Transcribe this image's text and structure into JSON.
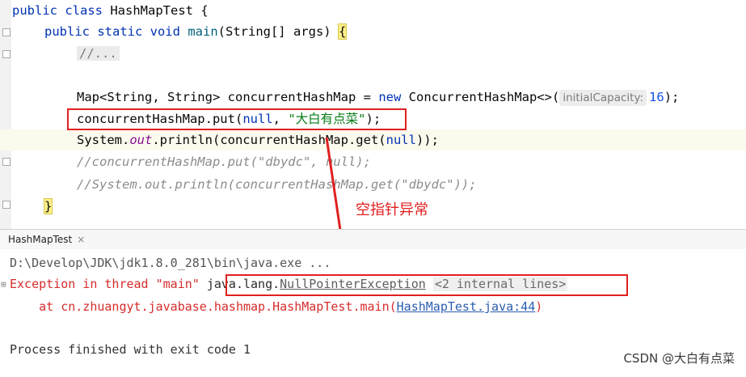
{
  "editor": {
    "line1": {
      "kw": "public class",
      "name": "HashMapTest",
      "brace": "{"
    },
    "line2": {
      "kw": "public static void",
      "fn": "main",
      "args": "(String[] args)",
      "brace": "{"
    },
    "line3": {
      "folded": "//..."
    },
    "line5": {
      "type": "Map<String, String>",
      "var": "concurrentHashMap",
      "eq": "=",
      "kw": "new",
      "ctor": "ConcurrentHashMap<>(",
      "hint": "initialCapacity:",
      "num": "16",
      "end": ");"
    },
    "line6": {
      "pre": "concurrentHashMap.put(",
      "kwnull": "null",
      "comma": ", ",
      "str": "\"大白有点菜\"",
      "end": ");"
    },
    "line7": {
      "pre": "System.",
      "out": "out",
      "mid": ".println(concurrentHashMap.get(",
      "kwnull": "null",
      "end": "));"
    },
    "line8": {
      "text": "//concurrentHashMap.put(\"dbydc\", null);"
    },
    "line9": {
      "text": "//System.out.println(concurrentHashMap.get(\"dbydc\"));"
    },
    "line10": {
      "brace": "}"
    }
  },
  "annotation": {
    "text": "空指针异常",
    "color": "#e02020"
  },
  "tab": {
    "label": "HashMapTest",
    "close": "×"
  },
  "console": {
    "cmd": "D:\\Develop\\JDK\\jdk1.8.0_281\\bin\\java.exe ...",
    "exc_prefix": "Exception in thread \"main\" ",
    "exc_pkg": "java.lang.",
    "exc_class": "NullPointerException",
    "exc_internal": "<2 internal lines>",
    "at_prefix": "    at cn.zhuangyt.javabase.hashmap.HashMapTest.main(",
    "at_link": "HashMapTest.java:44",
    "at_end": ")",
    "finished": "Process finished with exit code 1"
  },
  "watermark": "CSDN @大白有点菜"
}
